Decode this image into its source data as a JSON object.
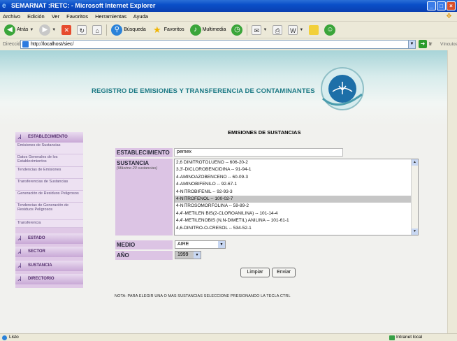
{
  "window": {
    "title": "SEMARNAT :RETC: - Microsoft Internet Explorer",
    "buttons": [
      "_",
      "□",
      "×"
    ]
  },
  "menubar": [
    "Archivo",
    "Edición",
    "Ver",
    "Favoritos",
    "Herramientas",
    "Ayuda"
  ],
  "toolbar": {
    "back": "Atrás",
    "search": "Búsqueda",
    "favorites": "Favoritos",
    "multimedia": "Multimedia"
  },
  "addressbar": {
    "label": "Dirección",
    "url": "http://localhost/siec/",
    "go": "Ir",
    "links": "Vínculos"
  },
  "banner": {
    "title": "REGISTRO DE EMISIONES Y TRANSFERENCIA DE CONTAMINANTES"
  },
  "sidebar": {
    "establecimiento": "ESTABLECIMIENTO",
    "sub_items": [
      "Emisiones de Sustancias",
      "Datos Generales de los Establecimientos",
      "Tendencias de Emisiones",
      "Transferencias de Sustancias",
      "Generación de Residuos Peligrosos",
      "Tendencias de Generación de Residuos Peligrosos",
      "Transferencia"
    ],
    "estado": "ESTADO",
    "sector": "SECTOR",
    "sustancia": "SUSTANCIA",
    "directorio": "DIRECTORIO"
  },
  "form": {
    "title": "EMISIONES DE SUSTANCIAS",
    "establecimiento_label": "ESTABLECIMIENTO",
    "establecimiento_value": "pemex",
    "sustancia_label": "SUSTANCIA",
    "sustancia_note": "(Máximo 20 sustancias)",
    "sustancias": [
      "2,6 DINITROTOLUENO -- 606-20-2",
      "3,3'-DICLOROBENCIDINA -- 91-94-1",
      "4-AMINOAZOBENCENO -- 60-09-3",
      "4-AMINOBIFENILO -- 92-67-1",
      "4-NITROBIFENIL -- 92-93-3",
      "4-NITROFENOL -- 100-02-7",
      "4-NITROSOMORFOLINA -- 59-89-2",
      "4,4'-METILEN BIS(2-CLOROANILINA) -- 101-14-4",
      "4,4'-METILENOBIS (N,N-DIMETIL) ANILINA -- 101-61-1",
      "4,6-DINITRO-O-CRESOL -- 534-52-1"
    ],
    "selected_sustancia_index": 5,
    "medio_label": "MEDIO",
    "medio_value": "AIRE",
    "anio_label": "AÑO",
    "anio_value": "1999",
    "limpiar": "Limpiar",
    "enviar": "Enviar",
    "note": "NOTA: PARA ELEGIR UNA O MAS SUSTANCIAS SELECCIONE PRESIONANDO LA TECLA CTRL"
  },
  "statusbar": {
    "left": "Listo",
    "right": "Intranet local"
  }
}
